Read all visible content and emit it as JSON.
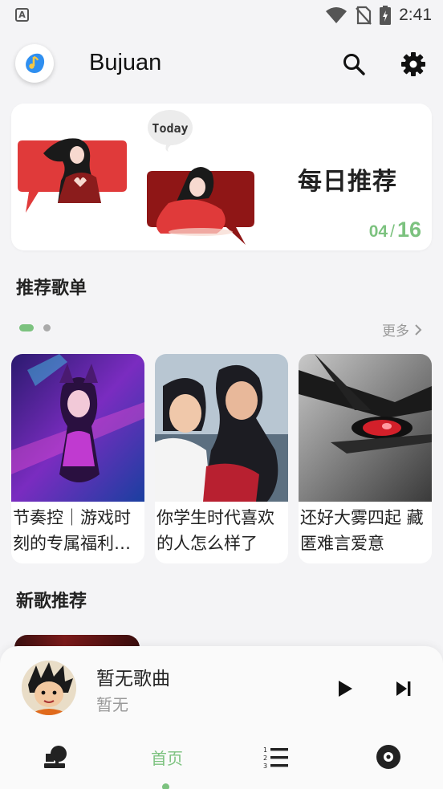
{
  "status_bar": {
    "keyboard_icon_letter": "A",
    "time": "2:41",
    "icons": [
      "wifi-icon",
      "no-sim-icon",
      "battery-charging-icon"
    ]
  },
  "header": {
    "app_title": "Bujuan",
    "logo_icon": "music-note-logo-icon",
    "search_icon": "search-icon",
    "settings_icon": "gear-icon"
  },
  "daily": {
    "bubble_text": "Today",
    "title": "每日推荐",
    "month": "04",
    "separator": "/",
    "day": "16"
  },
  "playlists": {
    "section_title": "推荐歌单",
    "more_label": "更多",
    "items": [
      {
        "name": "节奏控｜游戏时刻的专属福利单…"
      },
      {
        "name": "你学生时代喜欢的人怎么样了"
      },
      {
        "name": "还好大雾四起 藏匿难言爱意"
      }
    ]
  },
  "new_songs": {
    "section_title": "新歌推荐"
  },
  "player": {
    "song": "暂无歌曲",
    "artist": "暂无",
    "play_icon": "play-icon",
    "next_icon": "skip-next-icon"
  },
  "tabbar": {
    "items": [
      {
        "icon": "podcast-mic-icon"
      },
      {
        "label": "首页"
      },
      {
        "icon": "playlist-icon"
      },
      {
        "icon": "vinyl-disc-icon"
      }
    ]
  },
  "colors": {
    "accent": "#7cc27f",
    "background": "#f4f4f6"
  }
}
